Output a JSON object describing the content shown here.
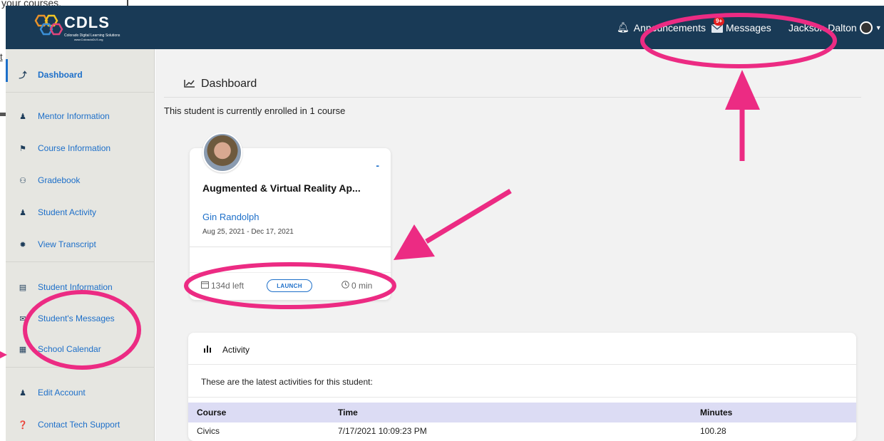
{
  "background_page": {
    "fragment_text": "your courses.",
    "fragment_link": "t"
  },
  "brand": {
    "logo_text": "CDLS",
    "logo_subtitle": "Colorado Digital Learning Solutions",
    "logo_url": "www.ColoradoDLS.org"
  },
  "topbar": {
    "announcements_label": "Announcements",
    "messages_label": "Messages",
    "messages_badge": "9+",
    "user_name": "Jackson Dalton"
  },
  "sidebar": {
    "items": [
      {
        "label": "Dashboard",
        "icon": "chart-line-icon",
        "glyph": "⤴",
        "active": true
      },
      {
        "label": "Mentor Information",
        "icon": "mentor-icon",
        "glyph": "♟"
      },
      {
        "label": "Course Information",
        "icon": "graduation-icon",
        "glyph": "⚑"
      },
      {
        "label": "Gradebook",
        "icon": "award-icon",
        "glyph": "⚇"
      },
      {
        "label": "Student Activity",
        "icon": "users-icon",
        "glyph": "♟"
      },
      {
        "label": "View Transcript",
        "icon": "badge-icon",
        "glyph": "✹"
      },
      {
        "label": "Student Information",
        "icon": "id-card-icon",
        "glyph": "▤"
      },
      {
        "label": "Student's Messages",
        "icon": "envelope-icon",
        "glyph": "✉"
      },
      {
        "label": "School Calendar",
        "icon": "calendar-icon",
        "glyph": "▦"
      },
      {
        "label": "Edit Account",
        "icon": "user-edit-icon",
        "glyph": "♟"
      },
      {
        "label": "Contact Tech Support",
        "icon": "question-circle-icon",
        "glyph": "❓"
      }
    ]
  },
  "main": {
    "page_title": "Dashboard",
    "enrollment_text": "This student is currently enrolled in 1 course",
    "course_card": {
      "course_name": "Augmented & Virtual Reality Ap...",
      "status_dash": "-",
      "teacher": "Gin Randolph",
      "dates": "Aug 25, 2021 - Dec 17, 2021",
      "days_left": "134d left",
      "launch_label": "LAUNCH",
      "minutes": "0 min"
    },
    "activity": {
      "title": "Activity",
      "description": "These are the latest activities for this student:",
      "columns": [
        "Course",
        "Time",
        "Minutes"
      ],
      "rows": [
        {
          "course": "Civics",
          "time": "7/17/2021 10:09:23 PM",
          "minutes": "100.28"
        }
      ]
    }
  },
  "colors": {
    "topbar_bg": "#193a56",
    "sidebar_bg": "#e6e6e1",
    "link_blue": "#1d6fc9",
    "annotation_pink": "#ec2b83",
    "table_header_bg": "#dcdcf4"
  }
}
